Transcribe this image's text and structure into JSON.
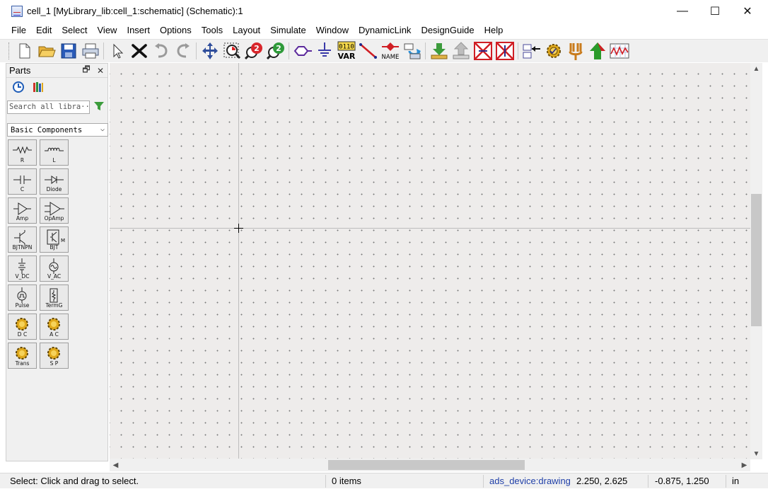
{
  "window": {
    "title": "cell_1 [MyLibrary_lib:cell_1:schematic] (Schematic):1",
    "minimize_glyph": "—",
    "maximize_glyph": "☐",
    "close_glyph": "✕"
  },
  "menu": [
    "File",
    "Edit",
    "Select",
    "View",
    "Insert",
    "Options",
    "Tools",
    "Layout",
    "Simulate",
    "Window",
    "DynamicLink",
    "DesignGuide",
    "Help"
  ],
  "toolbar": {
    "icons": [
      "new-icon",
      "open-folder-icon",
      "save-icon",
      "print-icon",
      "select-arrow-icon",
      "delete-x-icon",
      "undo-icon",
      "redo-icon",
      "move-icon",
      "zoom-area-icon",
      "zoom-in-icon",
      "zoom-out-icon",
      "port-icon",
      "ground-icon",
      "var-icon",
      "wire-icon",
      "name-icon",
      "update-icon",
      "download-icon",
      "upload-icon",
      "deactivate-icon",
      "deactivate-short-icon",
      "push-hierarchy-icon",
      "simulate-gear-icon",
      "tune-icon",
      "pop-hierarchy-icon",
      "display-results-icon"
    ],
    "var_label": "VAR",
    "var_top": "0110",
    "name_label": "NAME"
  },
  "parts": {
    "title": "Parts",
    "float_glyph": "🗗",
    "close_glyph": "✕",
    "search_placeholder": "Search all libra···",
    "library": "Basic Components",
    "components": [
      [
        "R",
        "L"
      ],
      [
        "C",
        "Diode"
      ],
      [
        "Amp",
        "OpAmp"
      ],
      [
        "BJTNPN",
        "BJT"
      ],
      [
        "V_DC",
        "V_AC"
      ],
      [
        "Pulse",
        "TermG"
      ],
      [
        "D C",
        "A C"
      ],
      [
        "Trans",
        "S P"
      ]
    ]
  },
  "status": {
    "message": "Select: Click and drag to select.",
    "items": "0 items",
    "layer": "ads_device:drawing",
    "coords": "2.250, 2.625",
    "delta": "-0.875, 1.250",
    "units": "in"
  },
  "colors": {
    "canvas": "#eeeceb",
    "grid_dot": "#7b7b7b",
    "layer_text": "#1f3fa8"
  }
}
